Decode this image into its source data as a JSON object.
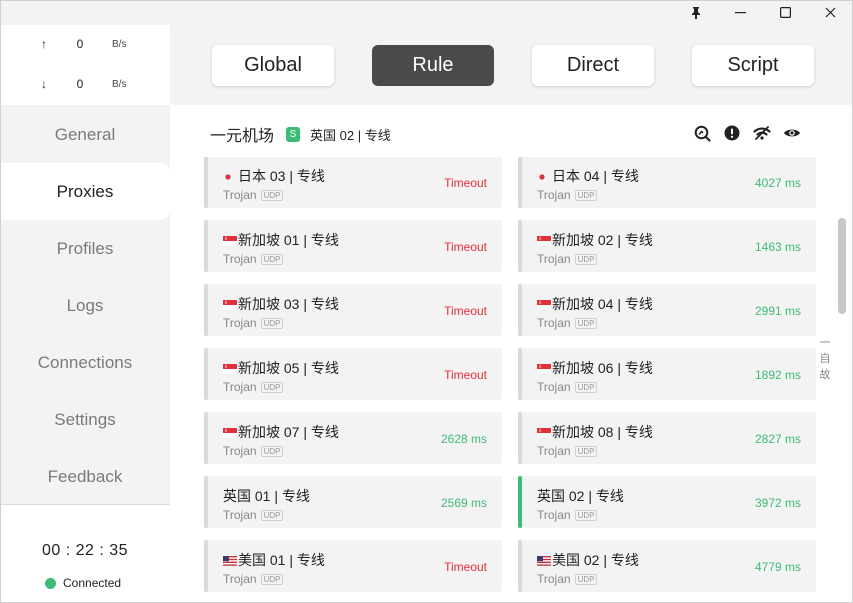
{
  "titlebar": {
    "icons": [
      "pin-icon",
      "minimize-icon",
      "maximize-icon",
      "close-icon"
    ],
    "glyphs": {
      "pin": "📌",
      "minimize": "—",
      "maximize": "☐",
      "close": "✕"
    }
  },
  "traffic": {
    "up": {
      "arrow": "↑",
      "value": "0",
      "unit": "B/s"
    },
    "down": {
      "arrow": "↓",
      "value": "0",
      "unit": "B/s"
    }
  },
  "nav": {
    "items": [
      {
        "label": "General",
        "active": false
      },
      {
        "label": "Proxies",
        "active": true
      },
      {
        "label": "Profiles",
        "active": false
      },
      {
        "label": "Logs",
        "active": false
      },
      {
        "label": "Connections",
        "active": false
      },
      {
        "label": "Settings",
        "active": false
      },
      {
        "label": "Feedback",
        "active": false
      }
    ]
  },
  "status": {
    "timer": "00 : 22 : 35",
    "text": "Connected",
    "color": "#3dbb77"
  },
  "modes": {
    "items": [
      {
        "label": "Global",
        "active": false
      },
      {
        "label": "Rule",
        "active": true
      },
      {
        "label": "Direct",
        "active": false
      },
      {
        "label": "Script",
        "active": false
      }
    ]
  },
  "group": {
    "title": "一元机场",
    "badge": "S",
    "selected": "英国 02 | 专线",
    "icons": [
      "speed-test-icon",
      "alert-icon",
      "wifi-icon",
      "eye-icon"
    ]
  },
  "proxies": [
    {
      "flag": "jp",
      "name": "日本 03 | 专线",
      "type": "Trojan",
      "udp": "UDP",
      "delay": "Timeout",
      "status": "timeout"
    },
    {
      "flag": "jp",
      "name": "日本 04 | 专线",
      "type": "Trojan",
      "udp": "UDP",
      "delay": "4027 ms",
      "status": "ok"
    },
    {
      "flag": "sg",
      "name": "新加坡 01 | 专线",
      "type": "Trojan",
      "udp": "UDP",
      "delay": "Timeout",
      "status": "timeout"
    },
    {
      "flag": "sg",
      "name": "新加坡 02 | 专线",
      "type": "Trojan",
      "udp": "UDP",
      "delay": "1463 ms",
      "status": "ok"
    },
    {
      "flag": "sg",
      "name": "新加坡 03 | 专线",
      "type": "Trojan",
      "udp": "UDP",
      "delay": "Timeout",
      "status": "timeout"
    },
    {
      "flag": "sg",
      "name": "新加坡 04 | 专线",
      "type": "Trojan",
      "udp": "UDP",
      "delay": "2991 ms",
      "status": "ok"
    },
    {
      "flag": "sg",
      "name": "新加坡 05 | 专线",
      "type": "Trojan",
      "udp": "UDP",
      "delay": "Timeout",
      "status": "timeout"
    },
    {
      "flag": "sg",
      "name": "新加坡 06 | 专线",
      "type": "Trojan",
      "udp": "UDP",
      "delay": "1892 ms",
      "status": "ok"
    },
    {
      "flag": "sg",
      "name": "新加坡 07 | 专线",
      "type": "Trojan",
      "udp": "UDP",
      "delay": "2628 ms",
      "status": "ok"
    },
    {
      "flag": "sg",
      "name": "新加坡 08 | 专线",
      "type": "Trojan",
      "udp": "UDP",
      "delay": "2827 ms",
      "status": "ok"
    },
    {
      "flag": "",
      "name": "英国 01 | 专线",
      "type": "Trojan",
      "udp": "UDP",
      "delay": "2569 ms",
      "status": "ok"
    },
    {
      "flag": "",
      "name": "英国 02 | 专线",
      "type": "Trojan",
      "udp": "UDP",
      "delay": "3972 ms",
      "status": "ok",
      "selected": true
    },
    {
      "flag": "us",
      "name": "美国 01 | 专线",
      "type": "Trojan",
      "udp": "UDP",
      "delay": "Timeout",
      "status": "timeout"
    },
    {
      "flag": "us",
      "name": "美国 02 | 专线",
      "type": "Trojan",
      "udp": "UDP",
      "delay": "4779 ms",
      "status": "ok"
    }
  ],
  "side_text": [
    "一",
    "自",
    "故"
  ],
  "colors": {
    "accent": "#3dbb77",
    "timeout": "#e0303a",
    "active_mode": "#4a4a4a"
  }
}
